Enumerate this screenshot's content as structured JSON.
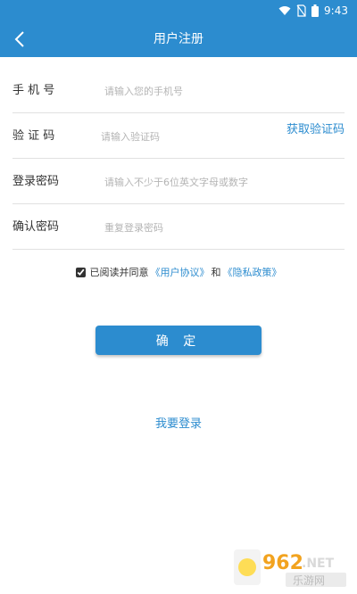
{
  "status_bar": {
    "time": "9:43"
  },
  "header": {
    "title": "用户注册"
  },
  "form": {
    "phone": {
      "label": "手 机 号",
      "placeholder": "请输入您的手机号"
    },
    "code": {
      "label": "验 证 码",
      "placeholder": "请输入验证码",
      "action": "获取验证码"
    },
    "password": {
      "label": "登录密码",
      "placeholder": "请输入不少于6位英文字母或数字"
    },
    "confirm_password": {
      "label": "确认密码",
      "placeholder": "重复登录密码"
    }
  },
  "agreement": {
    "checked": true,
    "prefix": "已阅读并同意",
    "user_agreement": "《用户协议》",
    "and": "和",
    "privacy_policy": "《隐私政策》"
  },
  "confirm_button": {
    "label": "确 定"
  },
  "login_link": {
    "label": "我要登录"
  },
  "watermark": {
    "number": "962",
    "suffix": ".NET",
    "name": "乐游网"
  },
  "colors": {
    "primary": "#2c8ccf",
    "divider": "#e1e1e1",
    "placeholder": "#b4b4b4"
  }
}
